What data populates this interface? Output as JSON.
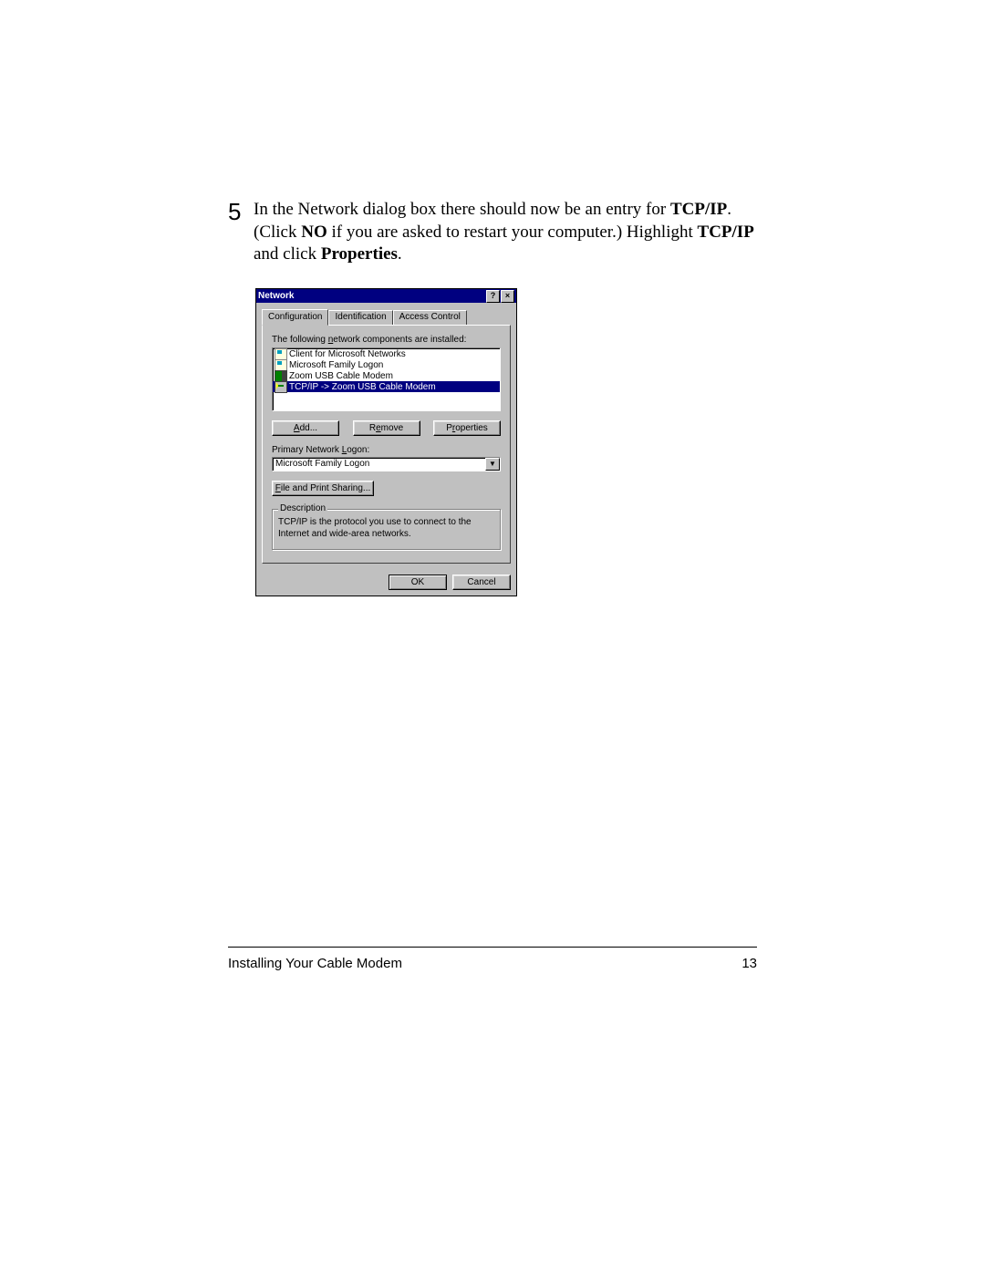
{
  "step": {
    "number": "5",
    "text_plain": "In the Network dialog box there should now be an entry for TCP/IP. (Click NO if you are asked to restart your computer.) Highlight TCP/IP and click Properties."
  },
  "dialog": {
    "title": "Network",
    "help_glyph": "?",
    "close_glyph": "×",
    "tabs": [
      "Configuration",
      "Identification",
      "Access Control"
    ],
    "active_tab": "Configuration",
    "instruction_pre": "The following ",
    "instruction_ul": "n",
    "instruction_post": "etwork components are installed:",
    "components": [
      {
        "label": "Client for Microsoft Networks",
        "icon": "comp",
        "selected": false
      },
      {
        "label": "Microsoft Family Logon",
        "icon": "comp",
        "selected": false
      },
      {
        "label": "Zoom USB Cable Modem",
        "icon": "adapter",
        "selected": false
      },
      {
        "label": "TCP/IP -> Zoom USB Cable Modem",
        "icon": "proto",
        "selected": true
      }
    ],
    "buttons": {
      "add_ul": "A",
      "add_post": "dd...",
      "remove_pre": "R",
      "remove_ul": "e",
      "remove_post": "move",
      "props_pre": "P",
      "props_ul": "r",
      "props_post": "operties"
    },
    "primary_logon_label_pre": "Primary Network ",
    "primary_logon_label_ul": "L",
    "primary_logon_label_post": "ogon:",
    "primary_logon_value": "Microsoft Family Logon",
    "file_print_ul": "F",
    "file_print_post": "ile and Print Sharing...",
    "description_legend": "Description",
    "description_text": "TCP/IP is the protocol you use to connect to the Internet and wide-area networks.",
    "ok": "OK",
    "cancel": "Cancel"
  },
  "footer": {
    "left": "Installing Your Cable Modem",
    "right": "13"
  }
}
